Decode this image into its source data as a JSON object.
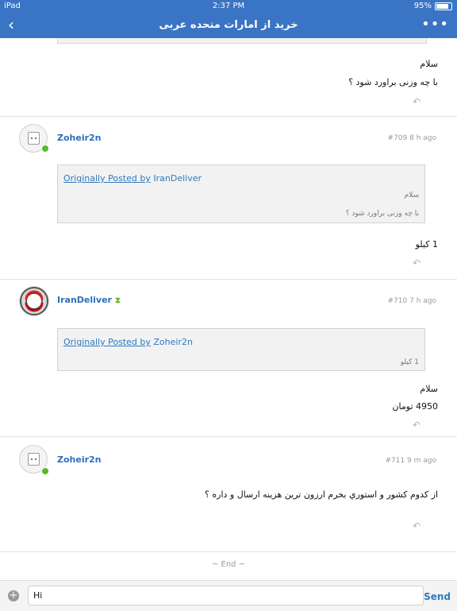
{
  "status": {
    "device": "iPad",
    "time": "2:37 PM",
    "battery": "95%"
  },
  "nav": {
    "back_icon": "‹",
    "title": "خرید از امارات متحده عربی",
    "more_icon": "•••"
  },
  "top_post": {
    "line1": "سلام",
    "line2": "با چه وزنی براورد شود ؟",
    "reply_icon": "↶"
  },
  "posts": [
    {
      "username": "Zoheir2n",
      "meta": "#709  8 h ago",
      "quote_prefix": "Originally Posted by",
      "quote_author": "IranDeliver",
      "quote_line1": "سلام",
      "quote_line2": "با چه وزنی براورد شود ؟",
      "body_line1": "1 کیلو",
      "reply_icon": "↶"
    },
    {
      "username": "IranDeliver",
      "meta": "#710  7 h ago",
      "quote_prefix": "Originally Posted by",
      "quote_author": "Zoheir2n",
      "quote_line1": "1 کیلو",
      "body_line1": "سلام",
      "body_line2": "4950 تومان",
      "reply_icon": "↶"
    },
    {
      "username": "Zoheir2n",
      "meta": "#711  9 m ago",
      "body_line1": "از کدوم کشور و استوري بخرم ارزون ترين هزينه ارسال و داره ؟",
      "reply_icon": "↶"
    }
  ],
  "end_label": "~ End ~",
  "composer": {
    "input_value": "Hi",
    "send_label": "Send",
    "add_icon": "+"
  }
}
